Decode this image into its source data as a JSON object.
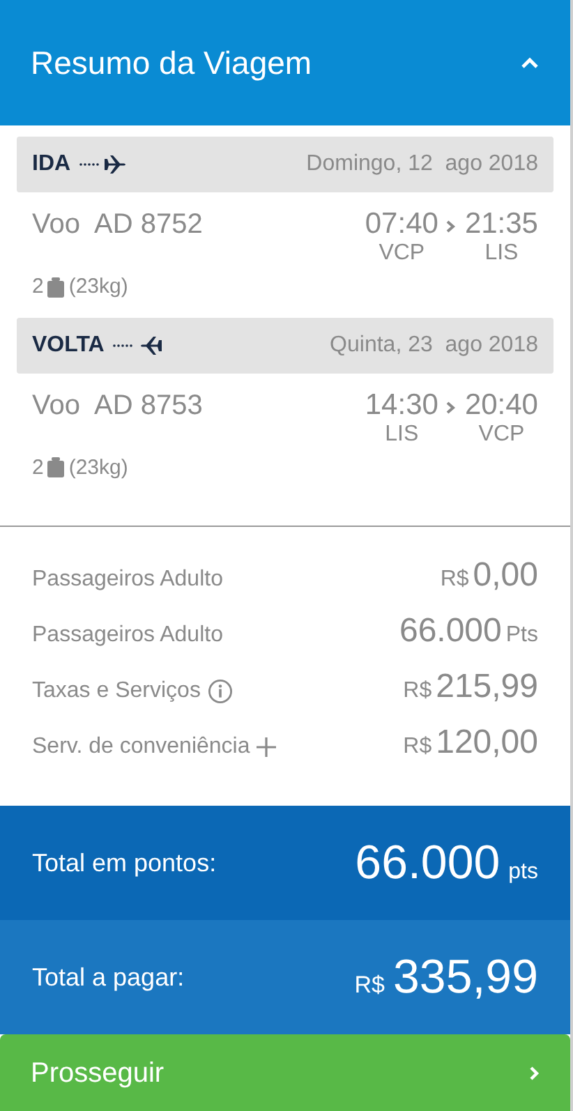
{
  "header": {
    "title": "Resumo da Viagem",
    "expanded": true
  },
  "segments": [
    {
      "label": "IDA",
      "kind": "outbound",
      "date": "Domingo, 12  ago 2018",
      "flight": "Voo  AD 8752",
      "depart_time": "07:40",
      "arrive_time": "21:35",
      "depart_airport": "VCP",
      "arrive_airport": "LIS",
      "bag_count": "2",
      "bag_weight": "(23kg)"
    },
    {
      "label": "VOLTA",
      "kind": "return",
      "date": "Quinta, 23  ago 2018",
      "flight": "Voo  AD 8753",
      "depart_time": "14:30",
      "arrive_time": "20:40",
      "depart_airport": "LIS",
      "arrive_airport": "VCP",
      "bag_count": "2",
      "bag_weight": "(23kg)"
    }
  ],
  "costs": [
    {
      "label": "Passageiros Adulto",
      "kind": "plain",
      "currency": "R$",
      "amount": "0,00"
    },
    {
      "label": "Passageiros Adulto",
      "kind": "plain",
      "amount": "66.000",
      "unit": "Pts"
    },
    {
      "label": "Taxas e Serviços",
      "kind": "info",
      "currency": "R$",
      "amount": "215,99"
    },
    {
      "label": "Serv. de conveniência",
      "kind": "plus",
      "currency": "R$",
      "amount": "120,00"
    }
  ],
  "totals": [
    {
      "label": "Total em pontos:",
      "amount": "66.000",
      "unit": "pts"
    },
    {
      "label": "Total a pagar:",
      "currency": "R$",
      "amount": "335,99"
    }
  ],
  "button": {
    "label": "Prosseguir"
  }
}
